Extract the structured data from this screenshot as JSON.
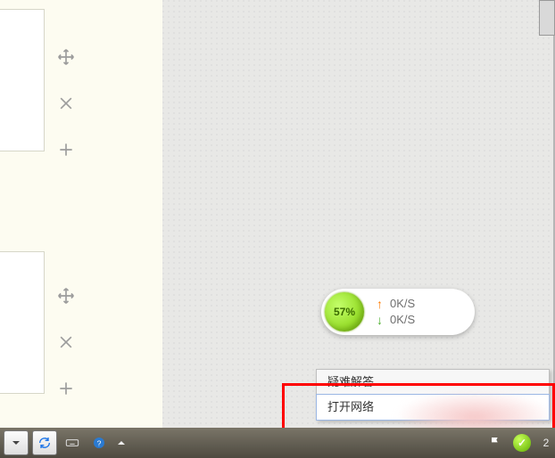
{
  "speed_widget": {
    "percent": "57%",
    "upload": "0K/S",
    "download": "0K/S"
  },
  "context_menu": {
    "item_faq": "疑难解答",
    "item_open": "打开网络"
  },
  "taskbar": {
    "time_label": "2"
  }
}
